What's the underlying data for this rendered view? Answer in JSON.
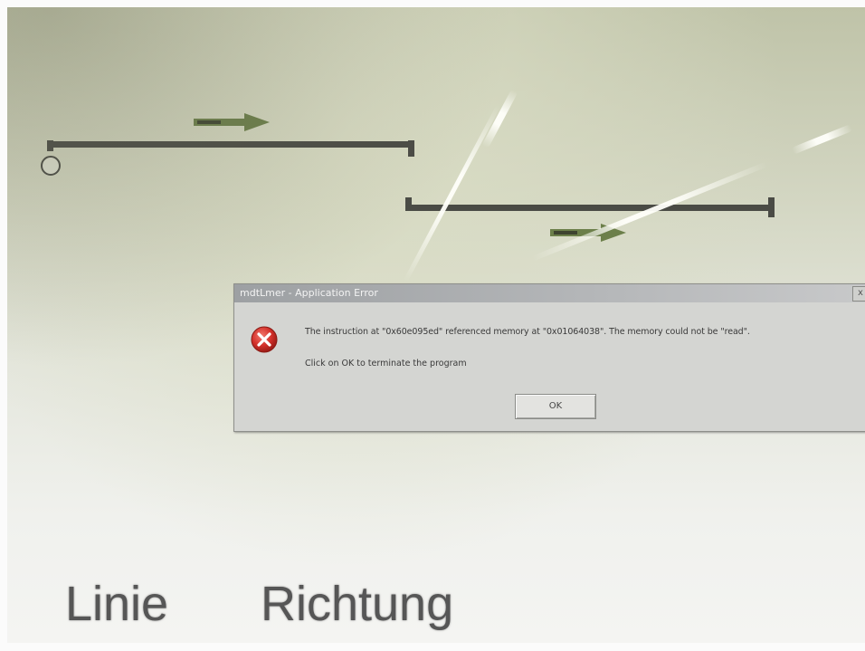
{
  "dialog": {
    "title": "mdtLmer - Application Error",
    "close_label": "x",
    "message": "The instruction at \"0x60e095ed\" referenced memory at \"0x01064038\". The memory could not be \"read\".",
    "hint": "Click on OK to terminate the program",
    "ok_label": "OK",
    "icon": "error-icon"
  },
  "footer": {
    "label_line": "Linie",
    "label_direction": "Richtung"
  },
  "colors": {
    "route_line": "#4a4b45",
    "arrow_fill": "#6c7f4a",
    "error_red": "#d3302a"
  }
}
